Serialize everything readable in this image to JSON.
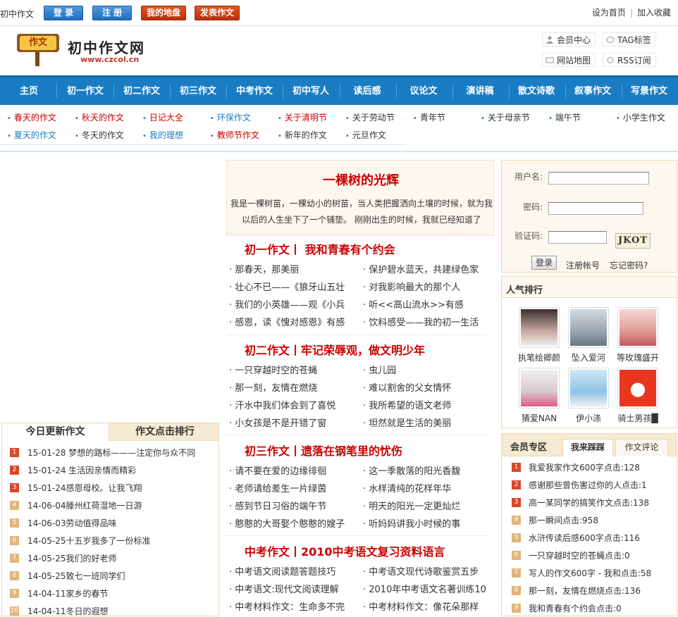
{
  "top": {
    "site_name": "初中作文",
    "login": "登 录",
    "register": "注 册",
    "my_space": "我的地盘",
    "publish": "发表作文",
    "set_home": "设为首页",
    "favorite": "加入收藏"
  },
  "logo": {
    "text": "作文",
    "name": "初中作文网",
    "url": "www.czcol.cn"
  },
  "header_links": [
    "会员中心",
    "TAG标签",
    "网站地图",
    "RSS订阅"
  ],
  "nav": [
    "主页",
    "初一作文",
    "初二作文",
    "初三作文",
    "中考作文",
    "初中写人",
    "读后感",
    "议论文",
    "演讲稿",
    "散文诗歌",
    "叙事作文",
    "写景作文"
  ],
  "tags_row1": [
    "春天的作文",
    "秋天的作文",
    "日记大全",
    "环保作文",
    "关于清明节",
    "关于劳动节",
    "青年节",
    "关于母亲节",
    "端午节",
    "小学生作文"
  ],
  "tags_row2": [
    "夏天的作文",
    "冬天的作文",
    "我的理想",
    "教师节作文",
    "新年的作文",
    "元旦作文"
  ],
  "feature": {
    "title": "一棵树的光辉",
    "text1": "我是一棵树苗，一棵幼小的树苗，当人类把握洒向土壤的时候，就为我",
    "text2": "以后的人生坐下了一个铺垫。 刚刚出生的时候，我就已经知道了"
  },
  "sections": [
    {
      "title": "初一作文丨  我和青春有个约会",
      "items": [
        "那春天，那美丽",
        "保护碧水蓝天，共建绿色家",
        "壮心不已——《狼牙山五壮",
        "对我影响最大的那个人",
        "我们的小英雄——观《小兵",
        "听<<高山流水>>有感",
        "感恩，读《愧对感恩》有感",
        "饮料感受——我的初一生活"
      ]
    },
    {
      "title": "初二作文丨牢记荣辱观，做文明少年",
      "items": [
        "一只穿越时空的苍蝇",
        "虫儿园",
        "那一刻，友情在燃烧",
        "难以割舍的父女情怀",
        "汗水中我们体会到了喜悦",
        "我所希望的语文老师",
        "小女孩是不是开错了窗",
        "坦然就是生活的美丽"
      ]
    },
    {
      "title": "初三作文丨遗落在钢笔里的忧伤",
      "items": [
        "请不要在爱的边缘徘徊",
        "这一季散落的阳光香馥",
        "老师请给差生一片绿茵",
        "水样清纯的花样年华",
        "感到节日习俗的端午节",
        "明天的阳光一定更灿烂",
        "憨憨的大哥娶个憨憨的嫂子",
        "听妈妈讲我小时候的事"
      ]
    },
    {
      "title": "中考作文丨2010中考语文复习资料语言",
      "items": [
        "中考语文阅读题答题技巧",
        "中考语文现代诗歌鉴赏五步",
        "中考语文:现代文阅读理解",
        "2010年中考语文名著训练10",
        "中考材料作文：生命多不完",
        "中考材料作文：像花朵那样"
      ]
    }
  ],
  "left_box": {
    "tab1": "今日更新作文",
    "tab2": "作文点击排行",
    "items": [
      {
        "n": "1",
        "text": "15-01-28 梦想的路标———注定你与众不同"
      },
      {
        "n": "2",
        "text": "15-01-24 生活因亲情而精彩"
      },
      {
        "n": "3",
        "text": "15-01-24感恩母校。让我飞翔"
      },
      {
        "n": "4",
        "text": "14-06-04滕州红荷湿地一日游"
      },
      {
        "n": "5",
        "text": "14-06-03劳动值得品味"
      },
      {
        "n": "6",
        "text": "14-05-25十五岁我多了一份标准"
      },
      {
        "n": "7",
        "text": "14-05-25我们的好老师"
      },
      {
        "n": "8",
        "text": "14-05-25致七一班同学们"
      },
      {
        "n": "9",
        "text": "14-04-11家乡的春节"
      },
      {
        "n": "10",
        "text": "14-04-11冬日的遐想"
      }
    ]
  },
  "login": {
    "user_label": "用户名:",
    "pass_label": "密码:",
    "code_label": "验证码:",
    "captcha": "JKOT",
    "submit": "登录",
    "register": "注册帐号",
    "forgot": "忘记密码?"
  },
  "popular": {
    "title": "人气排行",
    "users": [
      "执笔绘卿颜",
      "坠入爱河",
      "等玫瑰盛开",
      "猜爱NAN",
      "伊小涤",
      "骑士男孩█"
    ]
  },
  "right_box": {
    "tab1": "会员专区",
    "tab2": "我来踩踩",
    "tab3": "作文评论",
    "items": [
      {
        "n": "1",
        "text": "我爱我家作文600字点击:128"
      },
      {
        "n": "2",
        "text": "感谢那些曾伤害过你的人点击:1"
      },
      {
        "n": "3",
        "text": "高一某同学的搞笑作文点击:138"
      },
      {
        "n": "4",
        "text": "那一瞬间点击:958"
      },
      {
        "n": "5",
        "text": "水浒传读后感600字点击:116"
      },
      {
        "n": "6",
        "text": "一只穿越时空的苍蝇点击:0"
      },
      {
        "n": "7",
        "text": "写人的作文600字 - 我和点击:58"
      },
      {
        "n": "8",
        "text": "那一刻，友情在燃烧点击:136"
      },
      {
        "n": "9",
        "text": "我和青春有个约会点击:0"
      }
    ]
  },
  "colors": {
    "nav_blue": "#1a7dc3",
    "title_red": "#cc0000",
    "panel_bg": "#fdf8ef"
  }
}
